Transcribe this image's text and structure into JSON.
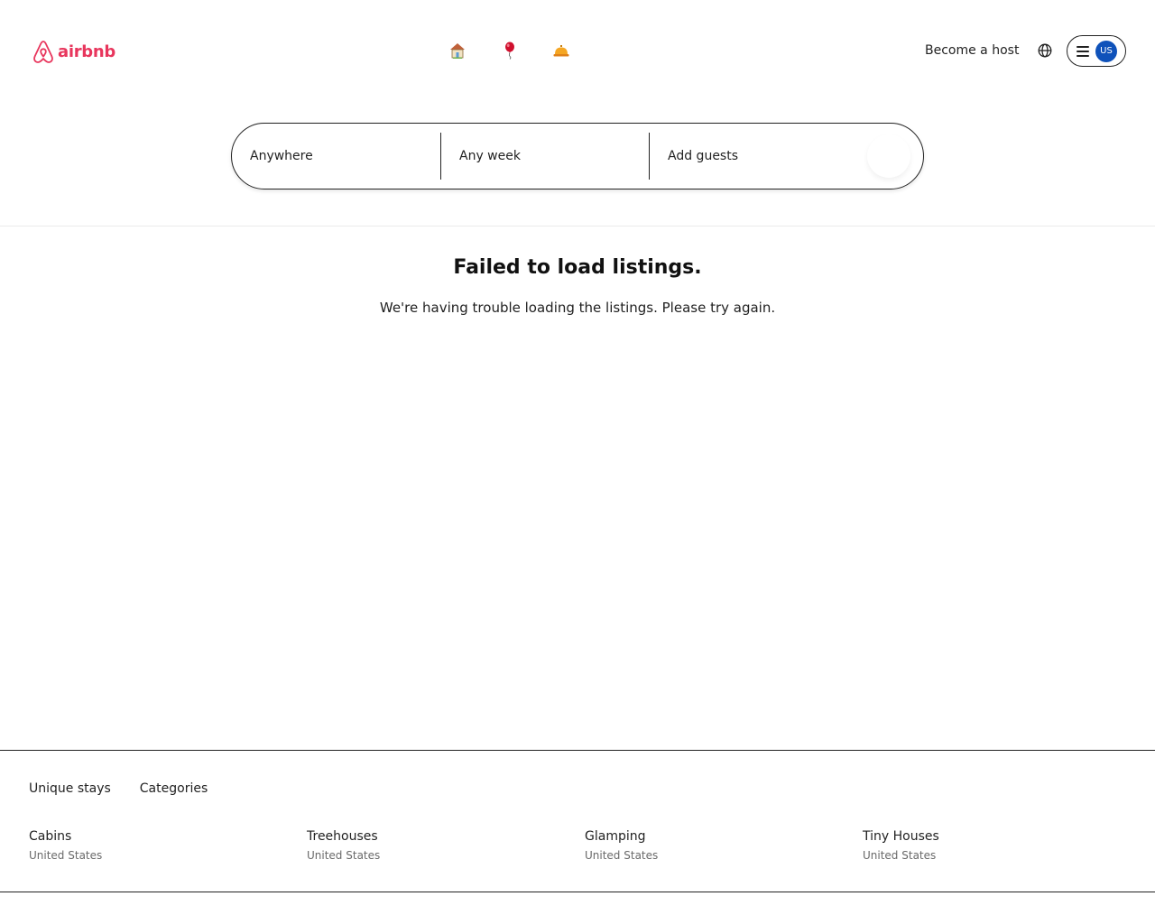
{
  "brand": {
    "name": "airbnb",
    "color": "#e8365d"
  },
  "nav": {
    "icons": [
      {
        "name": "homes",
        "icon": "house-icon"
      },
      {
        "name": "experiences",
        "icon": "balloon-icon"
      },
      {
        "name": "services",
        "icon": "service-bell-icon"
      }
    ]
  },
  "header": {
    "become_host": "Become a host",
    "globe_icon": "globe-icon",
    "menu_icon": "hamburger-icon",
    "avatar_initials": "US",
    "avatar_color": "#0f52ba"
  },
  "search": {
    "where": "Anywhere",
    "when": "Any week",
    "who": "Add guests"
  },
  "error": {
    "title": "Failed to load listings.",
    "message": "We're having trouble loading the listings. Please try again."
  },
  "footer": {
    "tabs": [
      "Unique stays",
      "Categories"
    ],
    "items": [
      {
        "title": "Cabins",
        "subtitle": "United States"
      },
      {
        "title": "Treehouses",
        "subtitle": "United States"
      },
      {
        "title": "Glamping",
        "subtitle": "United States"
      },
      {
        "title": "Tiny Houses",
        "subtitle": "United States"
      }
    ]
  }
}
